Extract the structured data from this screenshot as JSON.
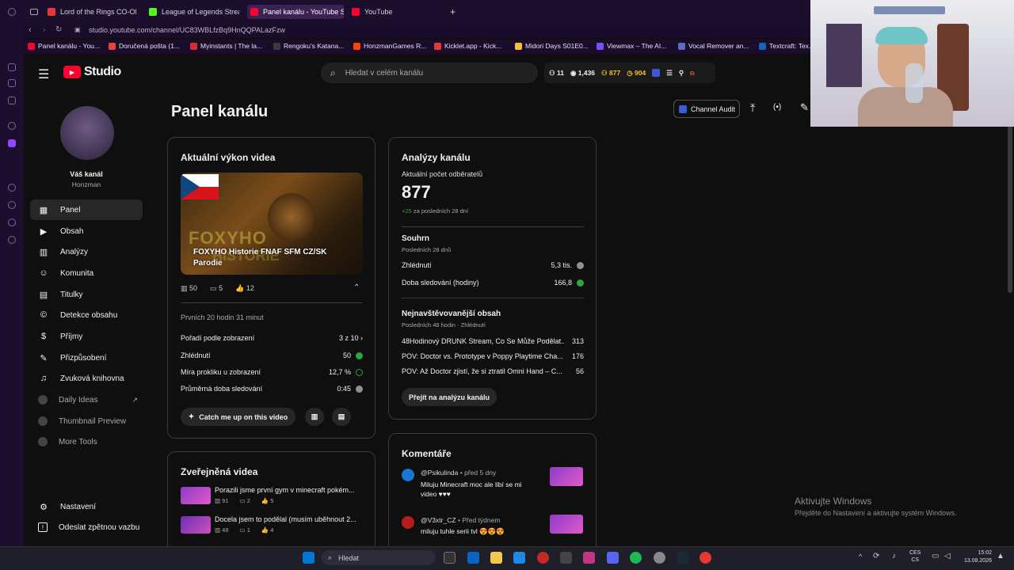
{
  "browser": {
    "tabs": [
      {
        "label": "Lord of the Rings CO-OP in",
        "color": "#e53935"
      },
      {
        "label": "League of Legends Stream",
        "color": "#53fc18"
      },
      {
        "label": "Panel kanálu - YouTube St",
        "color": "#ff0033"
      },
      {
        "label": "YouTube",
        "color": "#ff0033"
      }
    ],
    "url": "studio.youtube.com/channel/UC83WBLfzBq9HnQQPALazFzw",
    "bookmarks": [
      {
        "label": "Panel kanálu - You...",
        "color": "#ff0033"
      },
      {
        "label": "Doručená pošta (1...",
        "color": "#ea4335"
      },
      {
        "label": "Myinstants | The la...",
        "color": "#d32f2f"
      },
      {
        "label": "Rengoku's Katana...",
        "color": "#3a3a3a"
      },
      {
        "label": "HonzmanGames R...",
        "color": "#ff4500"
      },
      {
        "label": "Kicklet.app - Kick...",
        "color": "#e53935"
      },
      {
        "label": "Midori Days S01E0...",
        "color": "#fbc02d"
      },
      {
        "label": "Viewmax – The AI...",
        "color": "#7c4dff"
      },
      {
        "label": "Vocal Remover an...",
        "color": "#5c6bc0"
      },
      {
        "label": "Textcraft: Tex...",
        "color": "#1565c0"
      }
    ]
  },
  "header": {
    "logo_text": "Studio",
    "search_placeholder": "Hledat v celém kanálu",
    "stats": {
      "subs_delta": "11",
      "views": "1,436",
      "subs": "877",
      "watch": "904"
    }
  },
  "channel": {
    "label": "Váš kanál",
    "name": "Honzman"
  },
  "nav": [
    {
      "label": "Panel",
      "icon": "dashboard-icon",
      "glyph": "▦"
    },
    {
      "label": "Obsah",
      "icon": "content-icon",
      "glyph": "▶"
    },
    {
      "label": "Analýzy",
      "icon": "analytics-icon",
      "glyph": "▥"
    },
    {
      "label": "Komunita",
      "icon": "community-icon",
      "glyph": "☺"
    },
    {
      "label": "Titulky",
      "icon": "subtitles-icon",
      "glyph": "▤"
    },
    {
      "label": "Detekce obsahu",
      "icon": "copyright-icon",
      "glyph": "©"
    },
    {
      "label": "Příjmy",
      "icon": "monetization-icon",
      "glyph": "$"
    },
    {
      "label": "Přizpůsobení",
      "icon": "customization-icon",
      "glyph": "✎"
    },
    {
      "label": "Zvuková knihovna",
      "icon": "audio-library-icon",
      "glyph": "♫"
    }
  ],
  "nav_extra": [
    {
      "label": "Daily Ideas"
    },
    {
      "label": "Thumbnail Preview"
    },
    {
      "label": "More Tools"
    }
  ],
  "nav_bottom": [
    {
      "label": "Nastavení",
      "glyph": "⚙"
    },
    {
      "label": "Odeslat zpětnou vazbu",
      "glyph": "!"
    }
  ],
  "page_title": "Panel kanálu",
  "toolbar": {
    "audit_label": "Channel Audit"
  },
  "video_perf": {
    "title": "Aktuální výkon videa",
    "video_title": "FOXYHO Historie FNAF SFM CZ/SK Parodie",
    "thumb_text": "FOXYHO",
    "thumb_text2": "HISTORIE",
    "views": "50",
    "comments": "5",
    "likes": "12",
    "period": "Prvních 20 hodin 31 minut",
    "rows": [
      {
        "label": "Pořadí podle zobrazení",
        "value": "3 z 10"
      },
      {
        "label": "Zhlédnutí",
        "value": "50"
      },
      {
        "label": "Míra prokliku u zobrazení",
        "value": "12,7 %"
      },
      {
        "label": "Průměrná doba sledování",
        "value": "0:45"
      }
    ],
    "catch_up_label": "Catch me up on this video"
  },
  "analytics": {
    "title": "Analýzy kanálu",
    "subs_label": "Aktuální počet odběratelů",
    "subs_value": "877",
    "subs_delta": "+25",
    "subs_delta_suffix": "za posledních 28 dní",
    "summary_title": "Souhrn",
    "summary_period": "Posledních 28 dnů",
    "summary_rows": [
      {
        "label": "Zhlédnutí",
        "value": "5,3 tis."
      },
      {
        "label": "Doba sledování (hodiny)",
        "value": "166,8"
      }
    ],
    "top_title": "Nejnavštěvovanější obsah",
    "top_period": "Posledních 48 hodin · Zhlédnutí",
    "top_rows": [
      {
        "label": "48Hodinový DRUNK Stream, Co Se Může Podělat...",
        "value": "313"
      },
      {
        "label": "POV: Doctor vs. Prototype v Poppy Playtime Cha...",
        "value": "176"
      },
      {
        "label": "POV: Až Doctor zjistí, že si ztratil Omni Hand – C...",
        "value": "56"
      }
    ],
    "button_label": "Přejít na analýzu kanálu"
  },
  "published": {
    "title": "Zveřejněná videa",
    "items": [
      {
        "title": "Porazili jsme první gym v minecraft pokém...",
        "views": "91",
        "comments": "2",
        "likes": "5"
      },
      {
        "title": "Docela jsem to podělal (musím uběhnout 2...",
        "views": "48",
        "comments": "1",
        "likes": "4"
      }
    ]
  },
  "comments": {
    "title": "Komentáře",
    "items": [
      {
        "author": "@Psikulinda",
        "time": "• před 5 dny",
        "text": "Miluju Minecraft moc ale libí se mi video ♥♥♥"
      },
      {
        "author": "@V3xtr_CZ",
        "time": "• Před týdnem",
        "text": "miluju tuhle serii tvl 😍😍😍"
      }
    ]
  },
  "watermark": {
    "line1": "Aktivujte Windows",
    "line2": "Přejděte do Nastavení a aktivujte systém Windows."
  },
  "taskbar": {
    "search": "Hledat",
    "lang1": "CES",
    "lang2": "CS",
    "time": "15:02",
    "date": "13.08.2026"
  }
}
